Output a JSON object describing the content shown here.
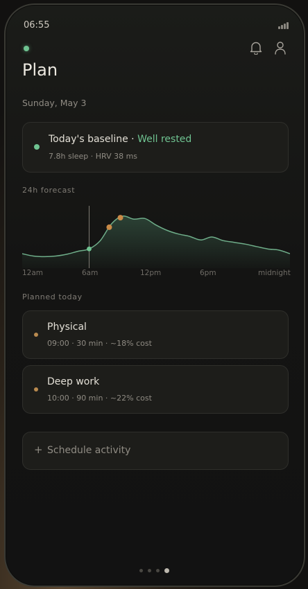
{
  "status_bar": {
    "time": "06:55",
    "signal_icon": "signal-bars-icon"
  },
  "header": {
    "title": "Plan",
    "notification_icon": "bell-icon",
    "profile_icon": "user-icon",
    "live_indicator_color": "#6fc391"
  },
  "date": "Sunday, May 3",
  "baseline": {
    "title": "Today's baseline",
    "separator": " · ",
    "status": "Well rested",
    "status_color": "#6fc391",
    "detail": "7.8h sleep · HRV 38 ms"
  },
  "forecast": {
    "label": "24h forecast",
    "x_labels": [
      "12am",
      "6am",
      "12pm",
      "6pm",
      "midnight"
    ]
  },
  "chart_data": {
    "type": "area",
    "x": [
      0,
      1,
      2,
      3,
      4,
      5,
      6,
      7,
      8,
      9,
      10,
      11,
      12,
      13,
      14,
      15,
      16,
      17,
      18,
      19,
      20,
      21,
      22,
      23,
      24
    ],
    "y": [
      22,
      18,
      17,
      18,
      21,
      26,
      30,
      44,
      72,
      85,
      80,
      81,
      70,
      61,
      55,
      51,
      45,
      50,
      44,
      41,
      38,
      34,
      30,
      28,
      22
    ],
    "ylim": [
      0,
      100
    ],
    "xlim": [
      0,
      24
    ],
    "x_tick_labels": [
      "12am",
      "6am",
      "12pm",
      "6pm",
      "midnight"
    ],
    "current_time_marker": 6,
    "line_color": "#6fae8a",
    "planned_markers": [
      {
        "x": 7.8,
        "color": "#c98a47"
      },
      {
        "x": 8.8,
        "color": "#c98a47"
      }
    ],
    "current_marker_color": "#6fc391"
  },
  "planned": {
    "label": "Planned today",
    "items": [
      {
        "name": "Physical",
        "detail": "09:00 · 30 min · ~18% cost"
      },
      {
        "name": "Deep work",
        "detail": "10:00 · 90 min · ~22% cost"
      }
    ]
  },
  "schedule": {
    "plus": "+",
    "label": "Schedule activity"
  },
  "pager": {
    "count": 4,
    "active_index": 3
  }
}
